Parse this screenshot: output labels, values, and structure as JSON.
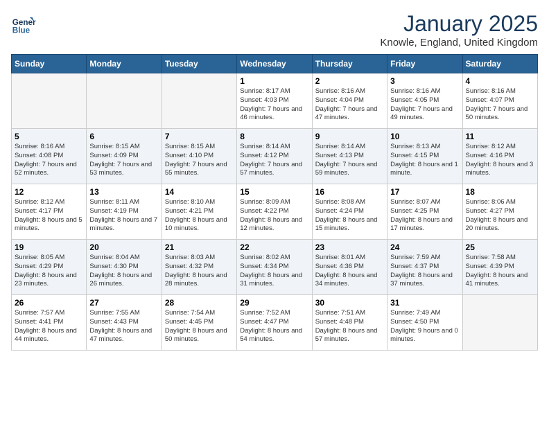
{
  "header": {
    "logo_line1": "General",
    "logo_line2": "Blue",
    "month": "January 2025",
    "location": "Knowle, England, United Kingdom"
  },
  "days_of_week": [
    "Sunday",
    "Monday",
    "Tuesday",
    "Wednesday",
    "Thursday",
    "Friday",
    "Saturday"
  ],
  "weeks": [
    [
      {
        "day": "",
        "info": ""
      },
      {
        "day": "",
        "info": ""
      },
      {
        "day": "",
        "info": ""
      },
      {
        "day": "1",
        "info": "Sunrise: 8:17 AM\nSunset: 4:03 PM\nDaylight: 7 hours and 46 minutes."
      },
      {
        "day": "2",
        "info": "Sunrise: 8:16 AM\nSunset: 4:04 PM\nDaylight: 7 hours and 47 minutes."
      },
      {
        "day": "3",
        "info": "Sunrise: 8:16 AM\nSunset: 4:05 PM\nDaylight: 7 hours and 49 minutes."
      },
      {
        "day": "4",
        "info": "Sunrise: 8:16 AM\nSunset: 4:07 PM\nDaylight: 7 hours and 50 minutes."
      }
    ],
    [
      {
        "day": "5",
        "info": "Sunrise: 8:16 AM\nSunset: 4:08 PM\nDaylight: 7 hours and 52 minutes."
      },
      {
        "day": "6",
        "info": "Sunrise: 8:15 AM\nSunset: 4:09 PM\nDaylight: 7 hours and 53 minutes."
      },
      {
        "day": "7",
        "info": "Sunrise: 8:15 AM\nSunset: 4:10 PM\nDaylight: 7 hours and 55 minutes."
      },
      {
        "day": "8",
        "info": "Sunrise: 8:14 AM\nSunset: 4:12 PM\nDaylight: 7 hours and 57 minutes."
      },
      {
        "day": "9",
        "info": "Sunrise: 8:14 AM\nSunset: 4:13 PM\nDaylight: 7 hours and 59 minutes."
      },
      {
        "day": "10",
        "info": "Sunrise: 8:13 AM\nSunset: 4:15 PM\nDaylight: 8 hours and 1 minute."
      },
      {
        "day": "11",
        "info": "Sunrise: 8:12 AM\nSunset: 4:16 PM\nDaylight: 8 hours and 3 minutes."
      }
    ],
    [
      {
        "day": "12",
        "info": "Sunrise: 8:12 AM\nSunset: 4:17 PM\nDaylight: 8 hours and 5 minutes."
      },
      {
        "day": "13",
        "info": "Sunrise: 8:11 AM\nSunset: 4:19 PM\nDaylight: 8 hours and 7 minutes."
      },
      {
        "day": "14",
        "info": "Sunrise: 8:10 AM\nSunset: 4:21 PM\nDaylight: 8 hours and 10 minutes."
      },
      {
        "day": "15",
        "info": "Sunrise: 8:09 AM\nSunset: 4:22 PM\nDaylight: 8 hours and 12 minutes."
      },
      {
        "day": "16",
        "info": "Sunrise: 8:08 AM\nSunset: 4:24 PM\nDaylight: 8 hours and 15 minutes."
      },
      {
        "day": "17",
        "info": "Sunrise: 8:07 AM\nSunset: 4:25 PM\nDaylight: 8 hours and 17 minutes."
      },
      {
        "day": "18",
        "info": "Sunrise: 8:06 AM\nSunset: 4:27 PM\nDaylight: 8 hours and 20 minutes."
      }
    ],
    [
      {
        "day": "19",
        "info": "Sunrise: 8:05 AM\nSunset: 4:29 PM\nDaylight: 8 hours and 23 minutes."
      },
      {
        "day": "20",
        "info": "Sunrise: 8:04 AM\nSunset: 4:30 PM\nDaylight: 8 hours and 26 minutes."
      },
      {
        "day": "21",
        "info": "Sunrise: 8:03 AM\nSunset: 4:32 PM\nDaylight: 8 hours and 28 minutes."
      },
      {
        "day": "22",
        "info": "Sunrise: 8:02 AM\nSunset: 4:34 PM\nDaylight: 8 hours and 31 minutes."
      },
      {
        "day": "23",
        "info": "Sunrise: 8:01 AM\nSunset: 4:36 PM\nDaylight: 8 hours and 34 minutes."
      },
      {
        "day": "24",
        "info": "Sunrise: 7:59 AM\nSunset: 4:37 PM\nDaylight: 8 hours and 37 minutes."
      },
      {
        "day": "25",
        "info": "Sunrise: 7:58 AM\nSunset: 4:39 PM\nDaylight: 8 hours and 41 minutes."
      }
    ],
    [
      {
        "day": "26",
        "info": "Sunrise: 7:57 AM\nSunset: 4:41 PM\nDaylight: 8 hours and 44 minutes."
      },
      {
        "day": "27",
        "info": "Sunrise: 7:55 AM\nSunset: 4:43 PM\nDaylight: 8 hours and 47 minutes."
      },
      {
        "day": "28",
        "info": "Sunrise: 7:54 AM\nSunset: 4:45 PM\nDaylight: 8 hours and 50 minutes."
      },
      {
        "day": "29",
        "info": "Sunrise: 7:52 AM\nSunset: 4:47 PM\nDaylight: 8 hours and 54 minutes."
      },
      {
        "day": "30",
        "info": "Sunrise: 7:51 AM\nSunset: 4:48 PM\nDaylight: 8 hours and 57 minutes."
      },
      {
        "day": "31",
        "info": "Sunrise: 7:49 AM\nSunset: 4:50 PM\nDaylight: 9 hours and 0 minutes."
      },
      {
        "day": "",
        "info": ""
      }
    ]
  ]
}
